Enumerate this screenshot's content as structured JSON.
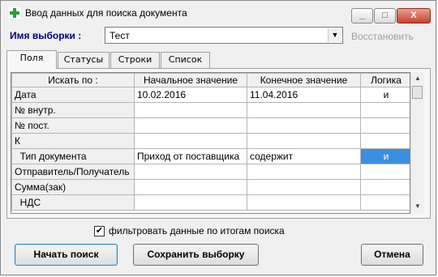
{
  "window": {
    "title": "Ввод данных для поиска документа",
    "minimize": "_",
    "maximize": "□",
    "close": "X"
  },
  "selection": {
    "label": "Имя выборки :",
    "value": "Тест",
    "restore_label": "Восстановить"
  },
  "tabs": [
    "Поля",
    "Статусы",
    "Строки",
    "Список"
  ],
  "grid": {
    "columns": [
      "Искать по :",
      "Начальное значение",
      "Конечное значение",
      "Логика"
    ],
    "rows": [
      {
        "field": "Дата",
        "start": "10.02.2016",
        "end": "11.04.2016",
        "logic": "и"
      },
      {
        "field": "№ внутр.",
        "start": "",
        "end": "",
        "logic": ""
      },
      {
        "field": "№ пост.",
        "start": "",
        "end": "",
        "logic": ""
      },
      {
        "field": "К",
        "start": "",
        "end": "",
        "logic": ""
      },
      {
        "field": "  Тип документа",
        "start": "Приход от поставщика",
        "end": "содержит",
        "logic": "и"
      },
      {
        "field": "Отправитель/Получатель",
        "start": "",
        "end": "",
        "logic": ""
      },
      {
        "field": "Сумма(зак)",
        "start": "",
        "end": "",
        "logic": ""
      },
      {
        "field": "  НДС",
        "start": "",
        "end": "",
        "logic": ""
      }
    ]
  },
  "filter_checkbox": {
    "label": "фильтровать данные по итогам поиска",
    "checked": true
  },
  "buttons": {
    "start": "Начать поиск",
    "save": "Сохранить выборку",
    "cancel": "Отмена"
  },
  "colors": {
    "selection": "#3b8fe0",
    "close_button": "#c8432b",
    "label_blue": "#000080"
  }
}
